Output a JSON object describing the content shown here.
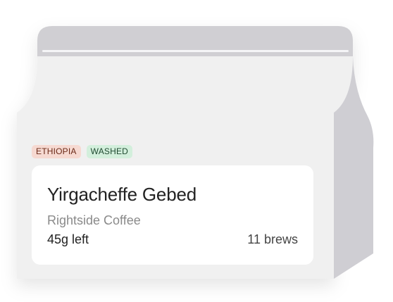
{
  "colors": {
    "bag_body": "#f0f0f0",
    "bag_top": "#d0cfd3",
    "bag_side": "#cfced3",
    "seal_line": "#f5f5f7",
    "card_bg": "#ffffff"
  },
  "bean": {
    "origin_tag": "ETHIOPIA",
    "process_tag": "WASHED",
    "name": "Yirgacheffe Gebed",
    "roaster": "Rightside Coffee",
    "remaining": "45g left",
    "brews": "11 brews"
  }
}
